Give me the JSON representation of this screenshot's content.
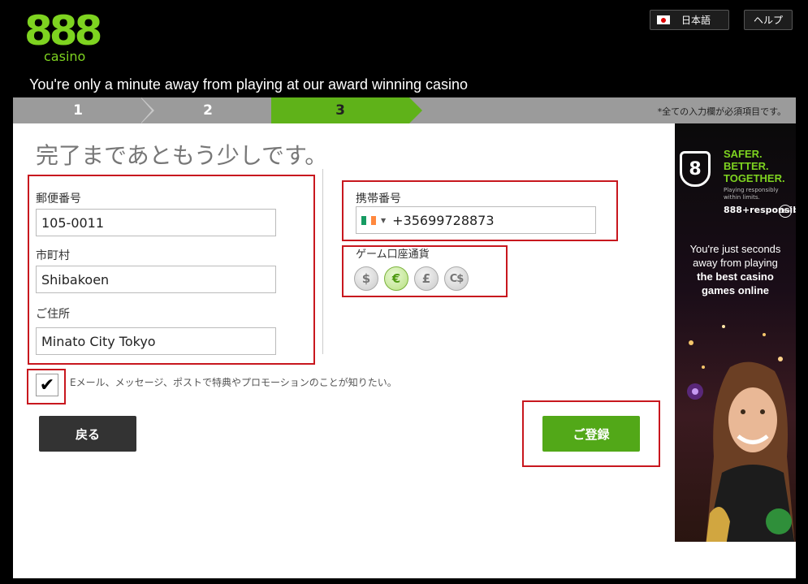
{
  "header": {
    "logo_main": "888",
    "logo_sub": "casino",
    "language_label": "日本語",
    "help_label": "ヘルプ",
    "tagline": "You're only a minute away from playing at our award winning casino"
  },
  "steps": {
    "items": [
      "1",
      "2",
      "3"
    ],
    "active": 3,
    "required_note": "*全ての入力欄が必須項目です。"
  },
  "form": {
    "title": "完了まであともう少しです。",
    "postal_code": {
      "label": "郵便番号",
      "value": "105-0011"
    },
    "city": {
      "label": "市町村",
      "value": "Shibakoen"
    },
    "address": {
      "label": "ご住所",
      "value": "Minato City Tokyo"
    },
    "mobile": {
      "label": "携帯番号",
      "value": "+35699728873",
      "flag_colors": [
        "#169b62",
        "#ffffff",
        "#ff883e"
      ]
    },
    "currency": {
      "label": "ゲーム口座通貨",
      "options": [
        "$",
        "€",
        "£",
        "C$"
      ],
      "selected": "€"
    },
    "consent": {
      "checked": true,
      "text": "Eメール、メッセージ、ポストで特典やプロモーションのことが知りたい。"
    },
    "back_label": "戻る",
    "register_label": "ご登録"
  },
  "ad": {
    "badge": "8",
    "headline": [
      "SAFER.",
      "BETTER.",
      "TOGETHER."
    ],
    "small_text": [
      "Playing responsibly",
      "within limits."
    ],
    "responsible": "888+responsible",
    "age": "18+",
    "body": [
      "You're just seconds",
      "away from playing"
    ],
    "body_bold": [
      "the best casino",
      "games online"
    ]
  },
  "colors": {
    "accent_green": "#52a818",
    "highlight_red": "#c8171e",
    "steps_gray": "#9b9b9b"
  }
}
